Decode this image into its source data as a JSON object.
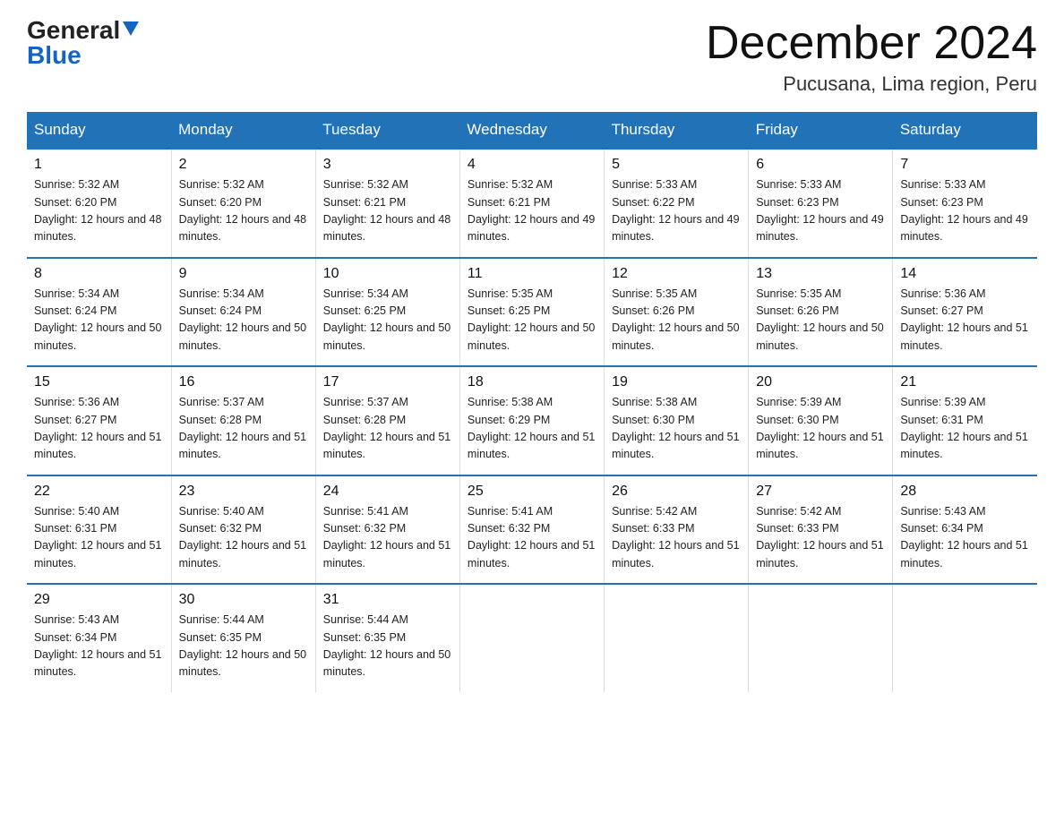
{
  "logo": {
    "general": "General",
    "blue": "Blue",
    "triangle": "▲"
  },
  "header": {
    "title": "December 2024",
    "subtitle": "Pucusana, Lima region, Peru"
  },
  "days_of_week": [
    "Sunday",
    "Monday",
    "Tuesday",
    "Wednesday",
    "Thursday",
    "Friday",
    "Saturday"
  ],
  "weeks": [
    [
      {
        "day": "1",
        "sunrise": "5:32 AM",
        "sunset": "6:20 PM",
        "daylight": "12 hours and 48 minutes."
      },
      {
        "day": "2",
        "sunrise": "5:32 AM",
        "sunset": "6:20 PM",
        "daylight": "12 hours and 48 minutes."
      },
      {
        "day": "3",
        "sunrise": "5:32 AM",
        "sunset": "6:21 PM",
        "daylight": "12 hours and 48 minutes."
      },
      {
        "day": "4",
        "sunrise": "5:32 AM",
        "sunset": "6:21 PM",
        "daylight": "12 hours and 49 minutes."
      },
      {
        "day": "5",
        "sunrise": "5:33 AM",
        "sunset": "6:22 PM",
        "daylight": "12 hours and 49 minutes."
      },
      {
        "day": "6",
        "sunrise": "5:33 AM",
        "sunset": "6:23 PM",
        "daylight": "12 hours and 49 minutes."
      },
      {
        "day": "7",
        "sunrise": "5:33 AM",
        "sunset": "6:23 PM",
        "daylight": "12 hours and 49 minutes."
      }
    ],
    [
      {
        "day": "8",
        "sunrise": "5:34 AM",
        "sunset": "6:24 PM",
        "daylight": "12 hours and 50 minutes."
      },
      {
        "day": "9",
        "sunrise": "5:34 AM",
        "sunset": "6:24 PM",
        "daylight": "12 hours and 50 minutes."
      },
      {
        "day": "10",
        "sunrise": "5:34 AM",
        "sunset": "6:25 PM",
        "daylight": "12 hours and 50 minutes."
      },
      {
        "day": "11",
        "sunrise": "5:35 AM",
        "sunset": "6:25 PM",
        "daylight": "12 hours and 50 minutes."
      },
      {
        "day": "12",
        "sunrise": "5:35 AM",
        "sunset": "6:26 PM",
        "daylight": "12 hours and 50 minutes."
      },
      {
        "day": "13",
        "sunrise": "5:35 AM",
        "sunset": "6:26 PM",
        "daylight": "12 hours and 50 minutes."
      },
      {
        "day": "14",
        "sunrise": "5:36 AM",
        "sunset": "6:27 PM",
        "daylight": "12 hours and 51 minutes."
      }
    ],
    [
      {
        "day": "15",
        "sunrise": "5:36 AM",
        "sunset": "6:27 PM",
        "daylight": "12 hours and 51 minutes."
      },
      {
        "day": "16",
        "sunrise": "5:37 AM",
        "sunset": "6:28 PM",
        "daylight": "12 hours and 51 minutes."
      },
      {
        "day": "17",
        "sunrise": "5:37 AM",
        "sunset": "6:28 PM",
        "daylight": "12 hours and 51 minutes."
      },
      {
        "day": "18",
        "sunrise": "5:38 AM",
        "sunset": "6:29 PM",
        "daylight": "12 hours and 51 minutes."
      },
      {
        "day": "19",
        "sunrise": "5:38 AM",
        "sunset": "6:30 PM",
        "daylight": "12 hours and 51 minutes."
      },
      {
        "day": "20",
        "sunrise": "5:39 AM",
        "sunset": "6:30 PM",
        "daylight": "12 hours and 51 minutes."
      },
      {
        "day": "21",
        "sunrise": "5:39 AM",
        "sunset": "6:31 PM",
        "daylight": "12 hours and 51 minutes."
      }
    ],
    [
      {
        "day": "22",
        "sunrise": "5:40 AM",
        "sunset": "6:31 PM",
        "daylight": "12 hours and 51 minutes."
      },
      {
        "day": "23",
        "sunrise": "5:40 AM",
        "sunset": "6:32 PM",
        "daylight": "12 hours and 51 minutes."
      },
      {
        "day": "24",
        "sunrise": "5:41 AM",
        "sunset": "6:32 PM",
        "daylight": "12 hours and 51 minutes."
      },
      {
        "day": "25",
        "sunrise": "5:41 AM",
        "sunset": "6:32 PM",
        "daylight": "12 hours and 51 minutes."
      },
      {
        "day": "26",
        "sunrise": "5:42 AM",
        "sunset": "6:33 PM",
        "daylight": "12 hours and 51 minutes."
      },
      {
        "day": "27",
        "sunrise": "5:42 AM",
        "sunset": "6:33 PM",
        "daylight": "12 hours and 51 minutes."
      },
      {
        "day": "28",
        "sunrise": "5:43 AM",
        "sunset": "6:34 PM",
        "daylight": "12 hours and 51 minutes."
      }
    ],
    [
      {
        "day": "29",
        "sunrise": "5:43 AM",
        "sunset": "6:34 PM",
        "daylight": "12 hours and 51 minutes."
      },
      {
        "day": "30",
        "sunrise": "5:44 AM",
        "sunset": "6:35 PM",
        "daylight": "12 hours and 50 minutes."
      },
      {
        "day": "31",
        "sunrise": "5:44 AM",
        "sunset": "6:35 PM",
        "daylight": "12 hours and 50 minutes."
      },
      null,
      null,
      null,
      null
    ]
  ],
  "labels": {
    "sunrise_prefix": "Sunrise: ",
    "sunset_prefix": "Sunset: ",
    "daylight_prefix": "Daylight: "
  }
}
